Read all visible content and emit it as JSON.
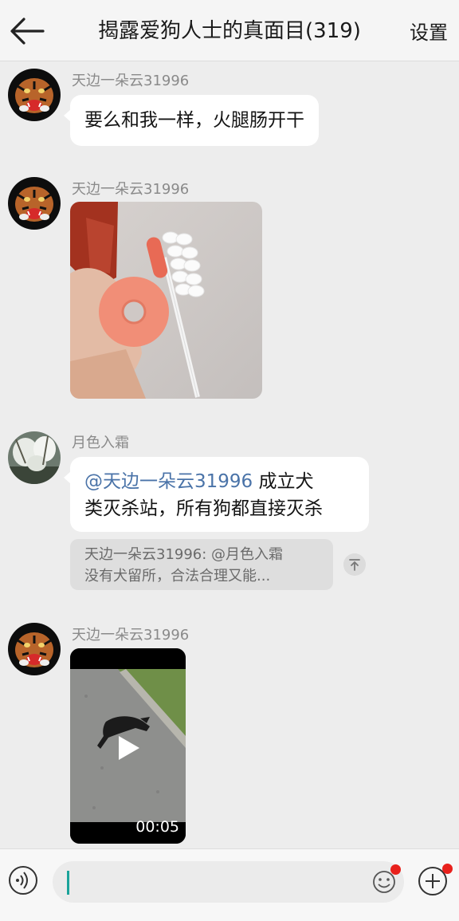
{
  "header": {
    "back_icon": "arrow-left-icon",
    "title": "揭露爱狗人士的真面目(319)",
    "settings_label": "设置"
  },
  "messages": [
    {
      "sender": "天边一朵云31996",
      "type": "text",
      "text": "要么和我一样，火腿肠开干"
    },
    {
      "sender": "天边一朵云31996",
      "type": "image",
      "image_desc": "photo-sausage-pills"
    },
    {
      "sender": "月色入霜",
      "type": "text",
      "mention": "@天边一朵云31996",
      "line1_rest": " 成立犬",
      "line2": "类灭杀站，所有狗都直接灭杀",
      "quote": {
        "line1": "天边一朵云31996: @月色入霜",
        "line2": "没有犬留所，合法合理又能..."
      }
    },
    {
      "sender": "天边一朵云31996",
      "type": "video",
      "duration": "00:05"
    }
  ],
  "input_bar": {
    "voice_icon": "voice-icon",
    "emoji_icon": "emoji-icon",
    "plus_icon": "plus-icon",
    "accent": "#1aa39a",
    "badge_color": "#e8211c"
  }
}
